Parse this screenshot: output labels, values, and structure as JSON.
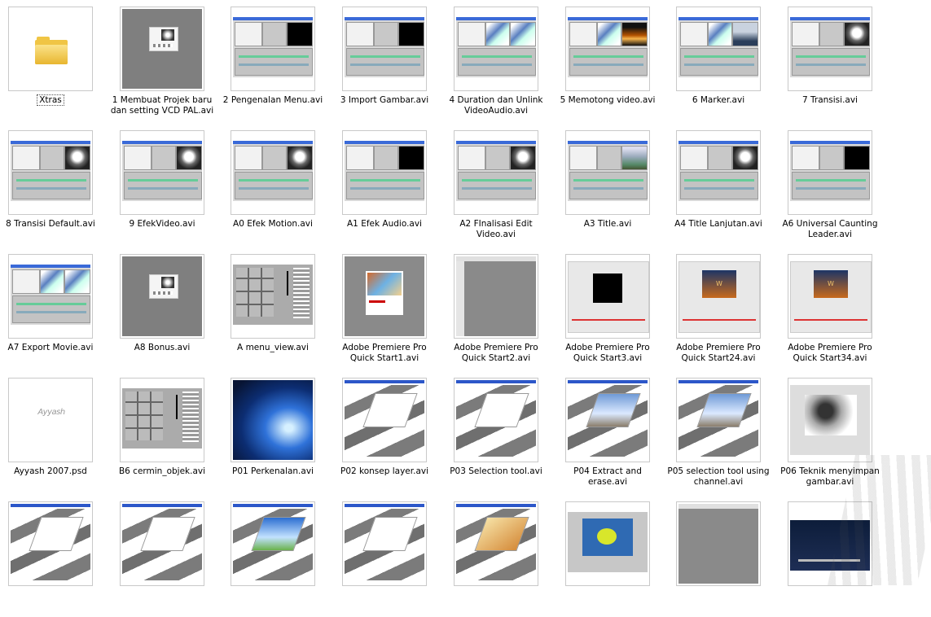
{
  "items": [
    {
      "name": "Xtras",
      "thumb": "folder"
    },
    {
      "name": "1 Membuat Projek baru dan setting VCD PAL.avi",
      "thumb": "gray-dialog"
    },
    {
      "name": "2 Pengenalan Menu.avi",
      "thumb": "ui-dark"
    },
    {
      "name": "3 Import Gambar.avi",
      "thumb": "ui-dark"
    },
    {
      "name": "4 Duration dan Unlink VideoAudio.avi",
      "thumb": "ui-image"
    },
    {
      "name": "5 Memotong video.avi",
      "thumb": "ui-sunset"
    },
    {
      "name": "6 Marker.avi",
      "thumb": "ui-city"
    },
    {
      "name": "7 Transisi.avi",
      "thumb": "ui-face"
    },
    {
      "name": "8 Transisi Default.avi",
      "thumb": "ui-face"
    },
    {
      "name": "9 EfekVideo.avi",
      "thumb": "ui-face"
    },
    {
      "name": "A0 Efek Motion.avi",
      "thumb": "ui-face"
    },
    {
      "name": "A1 Efek Audio.avi",
      "thumb": "ui-dark"
    },
    {
      "name": "A2 FInalisasi Edit Video.avi",
      "thumb": "ui-face"
    },
    {
      "name": "A3 Title.avi",
      "thumb": "ui-sky"
    },
    {
      "name": "A4 Title Lanjutan.avi",
      "thumb": "ui-face"
    },
    {
      "name": "A6 Universal Caunting Leader.avi",
      "thumb": "ui-dark"
    },
    {
      "name": "A7 Export Movie.avi",
      "thumb": "ui-image"
    },
    {
      "name": "A8 Bonus.avi",
      "thumb": "gray-dialog"
    },
    {
      "name": "A menu_view.avi",
      "thumb": "menu"
    },
    {
      "name": "Adobe Premiere Pro Quick Start1.avi",
      "thumb": "cover"
    },
    {
      "name": "Adobe Premiere Pro Quick Start2.avi",
      "thumb": "qs"
    },
    {
      "name": "Adobe Premiere Pro Quick Start3.avi",
      "thumb": "qs3"
    },
    {
      "name": "Adobe Premiere Pro Quick Start24.avi",
      "thumb": "wave"
    },
    {
      "name": "Adobe Premiere Pro Quick Start34.avi",
      "thumb": "wave"
    },
    {
      "name": "Ayyash 2007.psd",
      "thumb": "psd"
    },
    {
      "name": "B6 cermin_objek.avi",
      "thumb": "menu"
    },
    {
      "name": "P01 Perkenalan.avi",
      "thumb": "space"
    },
    {
      "name": "P02 konsep layer.avi",
      "thumb": "ps"
    },
    {
      "name": "P03 Selection tool.avi",
      "thumb": "ps"
    },
    {
      "name": "P04 Extract and erase.avi",
      "thumb": "ps-man"
    },
    {
      "name": "P05 selection tool using channel.avi",
      "thumb": "ps-man"
    },
    {
      "name": "P06 Teknik menyimpan gambar.avi",
      "thumb": "portrait"
    },
    {
      "name": "",
      "thumb": "ps"
    },
    {
      "name": "",
      "thumb": "ps"
    },
    {
      "name": "",
      "thumb": "ps-sky"
    },
    {
      "name": "",
      "thumb": "ps"
    },
    {
      "name": "",
      "thumb": "ps-leaf"
    },
    {
      "name": "",
      "thumb": "fish"
    },
    {
      "name": "",
      "thumb": "gray"
    },
    {
      "name": "",
      "thumb": "dark-box"
    }
  ],
  "psd_label": "Ayyash"
}
